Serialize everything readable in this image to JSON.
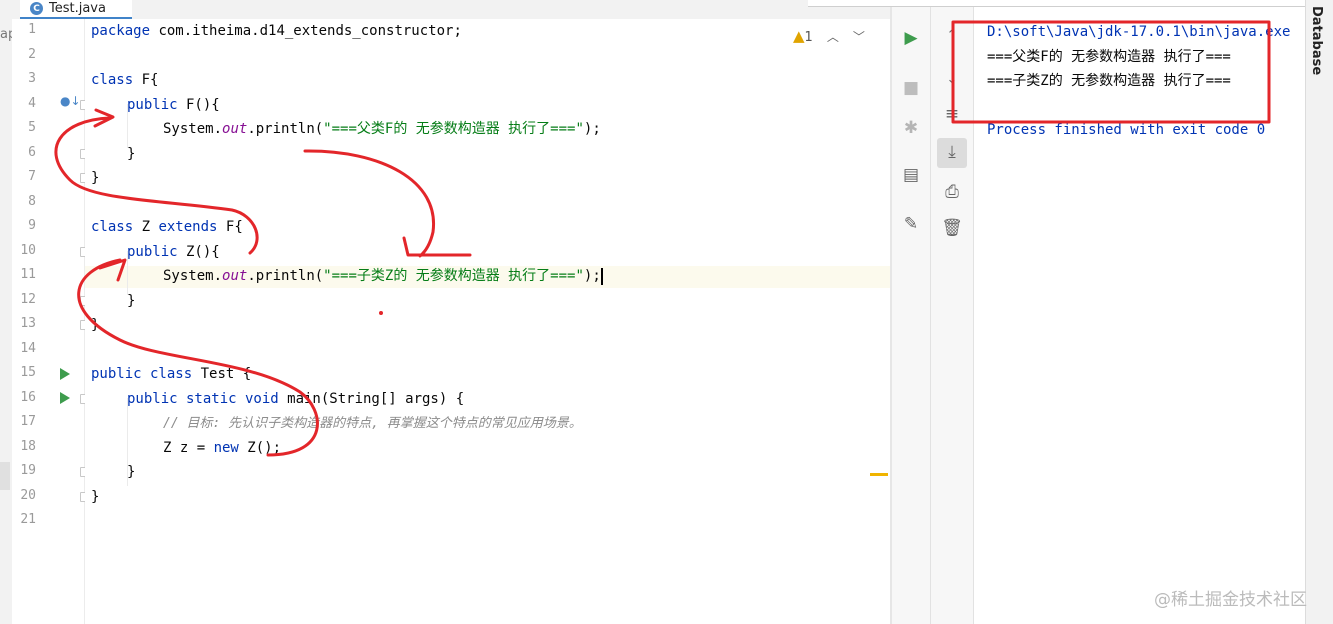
{
  "tab": {
    "icon_letter": "C",
    "filename": "Test.java"
  },
  "left_fragment": "ap",
  "gutter": {
    "line_numbers": [
      "1",
      "2",
      "3",
      "4",
      "5",
      "6",
      "7",
      "8",
      "9",
      "10",
      "11",
      "12",
      "13",
      "14",
      "15",
      "16",
      "17",
      "18",
      "19",
      "20",
      "21"
    ]
  },
  "code": {
    "l1_kw": "package",
    "l1_rest": " com.itheima.d14_extends_constructor;",
    "l3_kw": "class",
    "l3_rest": " F{",
    "l4_kw": "public",
    "l4_rest": " F(){",
    "l5_a": "System.",
    "l5_out": "out",
    "l5_b": ".println(",
    "l5_str": "\"===父类F的 无参数构造器 执行了===\"",
    "l5_c": ");",
    "l6": "}",
    "l7": "}",
    "l9_kw": "class",
    "l9_mid": " Z ",
    "l9_kw2": "extends",
    "l9_rest": " F{",
    "l10_kw": "public",
    "l10_rest": " Z(){",
    "l11_a": "System.",
    "l11_out": "out",
    "l11_b": ".println(",
    "l11_str": "\"===子类Z的 无参数构造器 执行了===\"",
    "l11_c": ");",
    "l12": "}",
    "l13": "}",
    "l15_kw": "public class",
    "l15_rest": " Test {",
    "l16_kw": "public static void",
    "l16_rest": " main(String[] args) {",
    "l17_cmt": "// 目标: 先认识子类构造器的特点, 再掌握这个特点的常见应用场景。",
    "l18_a": "Z z = ",
    "l18_kw": "new",
    "l18_b": " Z();",
    "l19": "}",
    "l20": "}"
  },
  "inspection": {
    "warning_count": "1"
  },
  "console": {
    "path": "D:\\soft\\Java\\jdk-17.0.1\\bin\\java.exe",
    "out1": "===父类F的 无参数构造器 执行了===",
    "out2": "===子类Z的 无参数构造器 执行了===",
    "exit": "Process finished with exit code 0"
  },
  "right_panel": {
    "label": "Database"
  },
  "watermark": "@稀土掘金技术社区",
  "colors": {
    "keyword": "#0033b3",
    "string": "#067d17",
    "annotation_red": "#e3262a",
    "run_green": "#3e9c4d"
  }
}
